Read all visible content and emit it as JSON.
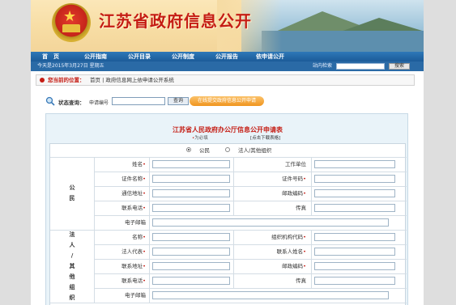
{
  "banner": {
    "title": "江苏省政府信息公开"
  },
  "nav": {
    "items": [
      "首　页",
      "公开指南",
      "公开目录",
      "公开制度",
      "公开报告",
      "依申请公开"
    ]
  },
  "date_bar": {
    "date": "今天是2015年3月27日  星期五",
    "search_label": "站内检索",
    "search_button": "搜索"
  },
  "breadcrumb": {
    "label": "您当前的位置：",
    "path": "首页 | 政府信息网上依申请公开系统"
  },
  "status_query": {
    "label": "状态查询：",
    "apply_no_label": "申请编号",
    "query_button": "查询",
    "apply_online_button": "在线提交政府信息公开申请"
  },
  "form": {
    "title": "江苏省人民政府办公厅信息公开申请表",
    "required_note": "为必填",
    "required_mark": "•",
    "download_link": "[点击下载表格]",
    "applicant_types": [
      {
        "label": "公民",
        "checked": true
      },
      {
        "label": "法人/其他组织",
        "checked": false
      }
    ],
    "citizen": {
      "group_label": [
        "公",
        "民"
      ],
      "rows": [
        {
          "left": {
            "label": "姓名",
            "required": true
          },
          "right": {
            "label": "工作单位",
            "required": false
          }
        },
        {
          "left": {
            "label": "证件名称",
            "required": true
          },
          "right": {
            "label": "证件号码",
            "required": true
          }
        },
        {
          "left": {
            "label": "通信地址",
            "required": true
          },
          "right": {
            "label": "邮政编码",
            "required": true
          }
        },
        {
          "left": {
            "label": "联系电话",
            "required": true
          },
          "right": {
            "label": "传真",
            "required": false
          }
        },
        {
          "left": {
            "label": "电子邮箱",
            "required": false
          }
        }
      ]
    },
    "legal": {
      "group_label": [
        "法",
        "人",
        "/",
        "其",
        "他",
        "组",
        "织"
      ],
      "rows": [
        {
          "left": {
            "label": "名称",
            "required": true
          },
          "right": {
            "label": "组织机构代码",
            "required": true
          }
        },
        {
          "left": {
            "label": "法人代表",
            "required": true
          },
          "right": {
            "label": "联系人姓名",
            "required": true
          }
        },
        {
          "left": {
            "label": "联系地址",
            "required": true
          },
          "right": {
            "label": "邮政编码",
            "required": true
          }
        },
        {
          "left": {
            "label": "联系电话",
            "required": true
          },
          "right": {
            "label": "传真",
            "required": false
          }
        },
        {
          "left": {
            "label": "电子邮箱",
            "required": false
          }
        }
      ]
    }
  }
}
